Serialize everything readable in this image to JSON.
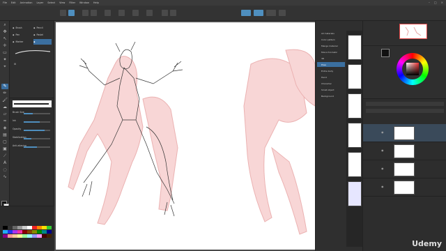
{
  "menu": [
    "File",
    "Edit",
    "Animation",
    "Layer",
    "Select",
    "View",
    "Filter",
    "Window",
    "Help"
  ],
  "subtool": {
    "items": [
      "Brush",
      "Pen",
      "Marker",
      "Pencil",
      "Pastel"
    ],
    "selected_index": 1
  },
  "properties": {
    "rows": [
      "Brush Size",
      "Ink",
      "Opacity",
      "Stabilization",
      "Anti-aliasing"
    ],
    "values": [
      0.35,
      0.6,
      0.8,
      0.3,
      0.5
    ]
  },
  "materials": {
    "folders": [
      "All materials",
      "Color pattern",
      "Manga material",
      "Monochromatic",
      "3D",
      "Pose",
      "Entire body",
      "Hand",
      "Character",
      "Small object",
      "Background"
    ],
    "selected_index": 5
  },
  "layers": {
    "selected_index": 0
  },
  "colors": {
    "accent": "#4f8fbf",
    "sketch": "#f2b8b8"
  },
  "watermark": "Udemy"
}
